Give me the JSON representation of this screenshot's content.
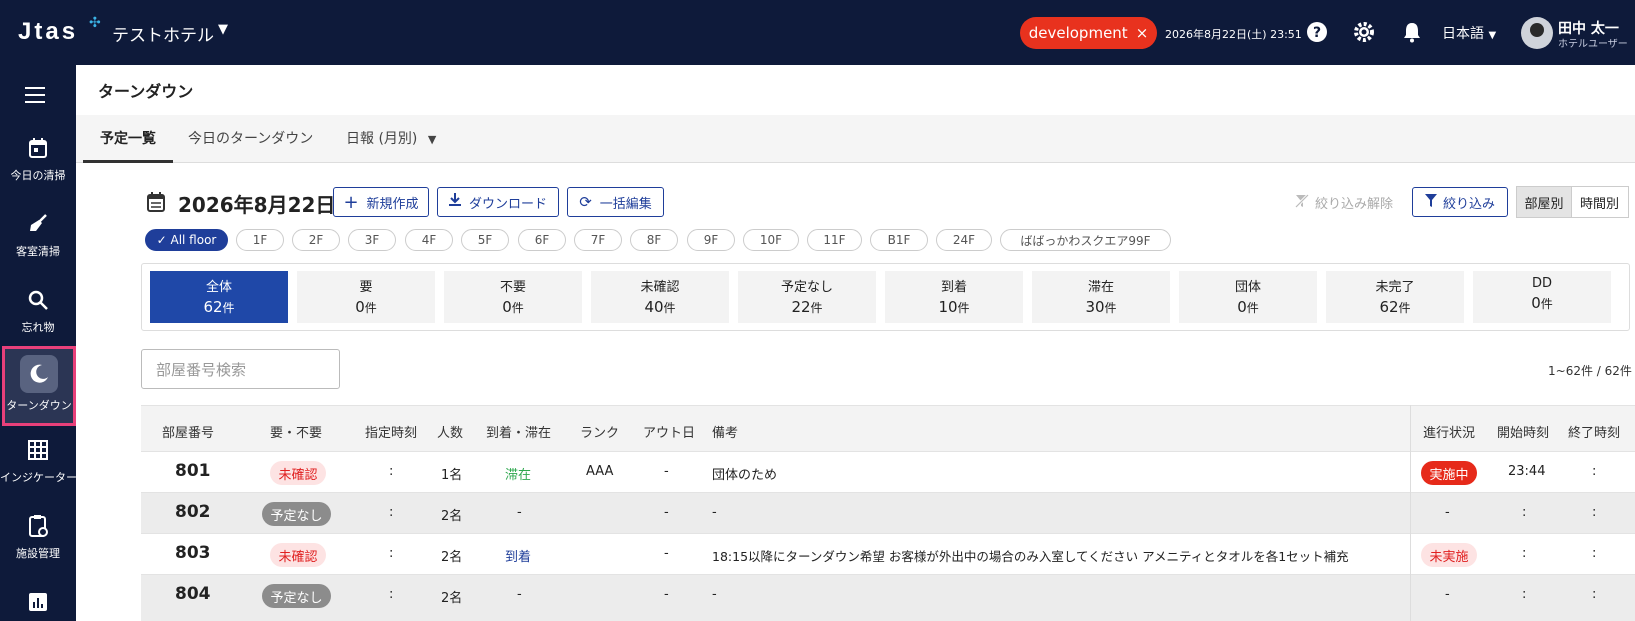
{
  "header": {
    "logo": "Jtas",
    "hotel_name": "テストホテル",
    "env_label": "development",
    "env_close": "×",
    "datetime": "2026年8月22日(土) 23:51",
    "language": "日本語",
    "user_name": "田中 太一",
    "user_role": "ホテルユーザー"
  },
  "sidebar": {
    "items": [
      {
        "label": "今日の清掃",
        "icon": "calendar-icon"
      },
      {
        "label": "客室清掃",
        "icon": "broom-icon"
      },
      {
        "label": "忘れ物",
        "icon": "search-icon"
      },
      {
        "label": "ターンダウン",
        "icon": "moon-icon",
        "active": true
      },
      {
        "label": "インジケーター",
        "icon": "grid-icon"
      },
      {
        "label": "施設管理",
        "icon": "clipboard-icon"
      },
      {
        "label": "",
        "icon": "chart-icon"
      }
    ]
  },
  "page": {
    "title": "ターンダウン",
    "tabs": [
      "予定一覧",
      "今日のターンダウン",
      "日報 (月別)"
    ],
    "date": "2026年8月22日",
    "buttons": {
      "new": "新規作成",
      "download": "ダウンロード",
      "bulk_edit": "一括編集"
    },
    "clear_filter": "絞り込み解除",
    "filter": "絞り込み",
    "view_room": "部屋別",
    "view_time": "時間別"
  },
  "floors": [
    "✓ All floor",
    "1F",
    "2F",
    "3F",
    "4F",
    "5F",
    "6F",
    "7F",
    "8F",
    "9F",
    "10F",
    "11F",
    "B1F",
    "24F",
    "ばばっかわスクエア99F"
  ],
  "summary": [
    {
      "label": "全体",
      "count": "62",
      "unit": "件"
    },
    {
      "label": "要",
      "count": "0",
      "unit": "件"
    },
    {
      "label": "不要",
      "count": "0",
      "unit": "件"
    },
    {
      "label": "未確認",
      "count": "40",
      "unit": "件"
    },
    {
      "label": "予定なし",
      "count": "22",
      "unit": "件"
    },
    {
      "label": "到着",
      "count": "10",
      "unit": "件"
    },
    {
      "label": "滞在",
      "count": "30",
      "unit": "件"
    },
    {
      "label": "団体",
      "count": "0",
      "unit": "件"
    },
    {
      "label": "未完了",
      "count": "62",
      "unit": "件"
    },
    {
      "label": "DD",
      "count": "0",
      "unit": "件"
    }
  ],
  "search": {
    "placeholder": "部屋番号検索"
  },
  "paging": "1~62件 / 62件",
  "table": {
    "headers": [
      "部屋番号",
      "要・不要",
      "指定時刻",
      "人数",
      "到着・滞在",
      "ランク",
      "アウト日",
      "備考",
      "進行状況",
      "開始時刻",
      "終了時刻"
    ],
    "rows": [
      {
        "room": "801",
        "need": "未確認",
        "time": ":",
        "people": "1名",
        "arrival": "滞在",
        "rank": "AAA",
        "out": "-",
        "note": "団体のため",
        "status": "実施中",
        "start": "23:44",
        "end": ":"
      },
      {
        "room": "802",
        "need": "予定なし",
        "time": ":",
        "people": "2名",
        "arrival": "-",
        "rank": "",
        "out": "-",
        "note": "-",
        "status": "-",
        "start": ":",
        "end": ":"
      },
      {
        "room": "803",
        "need": "未確認",
        "time": ":",
        "people": "2名",
        "arrival": "到着",
        "rank": "",
        "out": "-",
        "note": "18:15以降にターンダウン希望 お客様が外出中の場合のみ入室してください アメニティとタオルを各1セット補充",
        "status": "未実施",
        "start": ":",
        "end": ":"
      },
      {
        "room": "804",
        "need": "予定なし",
        "time": ":",
        "people": "2名",
        "arrival": "-",
        "rank": "",
        "out": "-",
        "note": "-",
        "status": "-",
        "start": ":",
        "end": ":"
      }
    ]
  },
  "colors": {
    "navy": "#0e1a3a",
    "primary": "#1f3e9a",
    "accent_red": "#e8321e",
    "active_border": "#e8407a",
    "arrival_stay": "#2fa84f",
    "arrival_arrive": "#1f3e9a"
  }
}
